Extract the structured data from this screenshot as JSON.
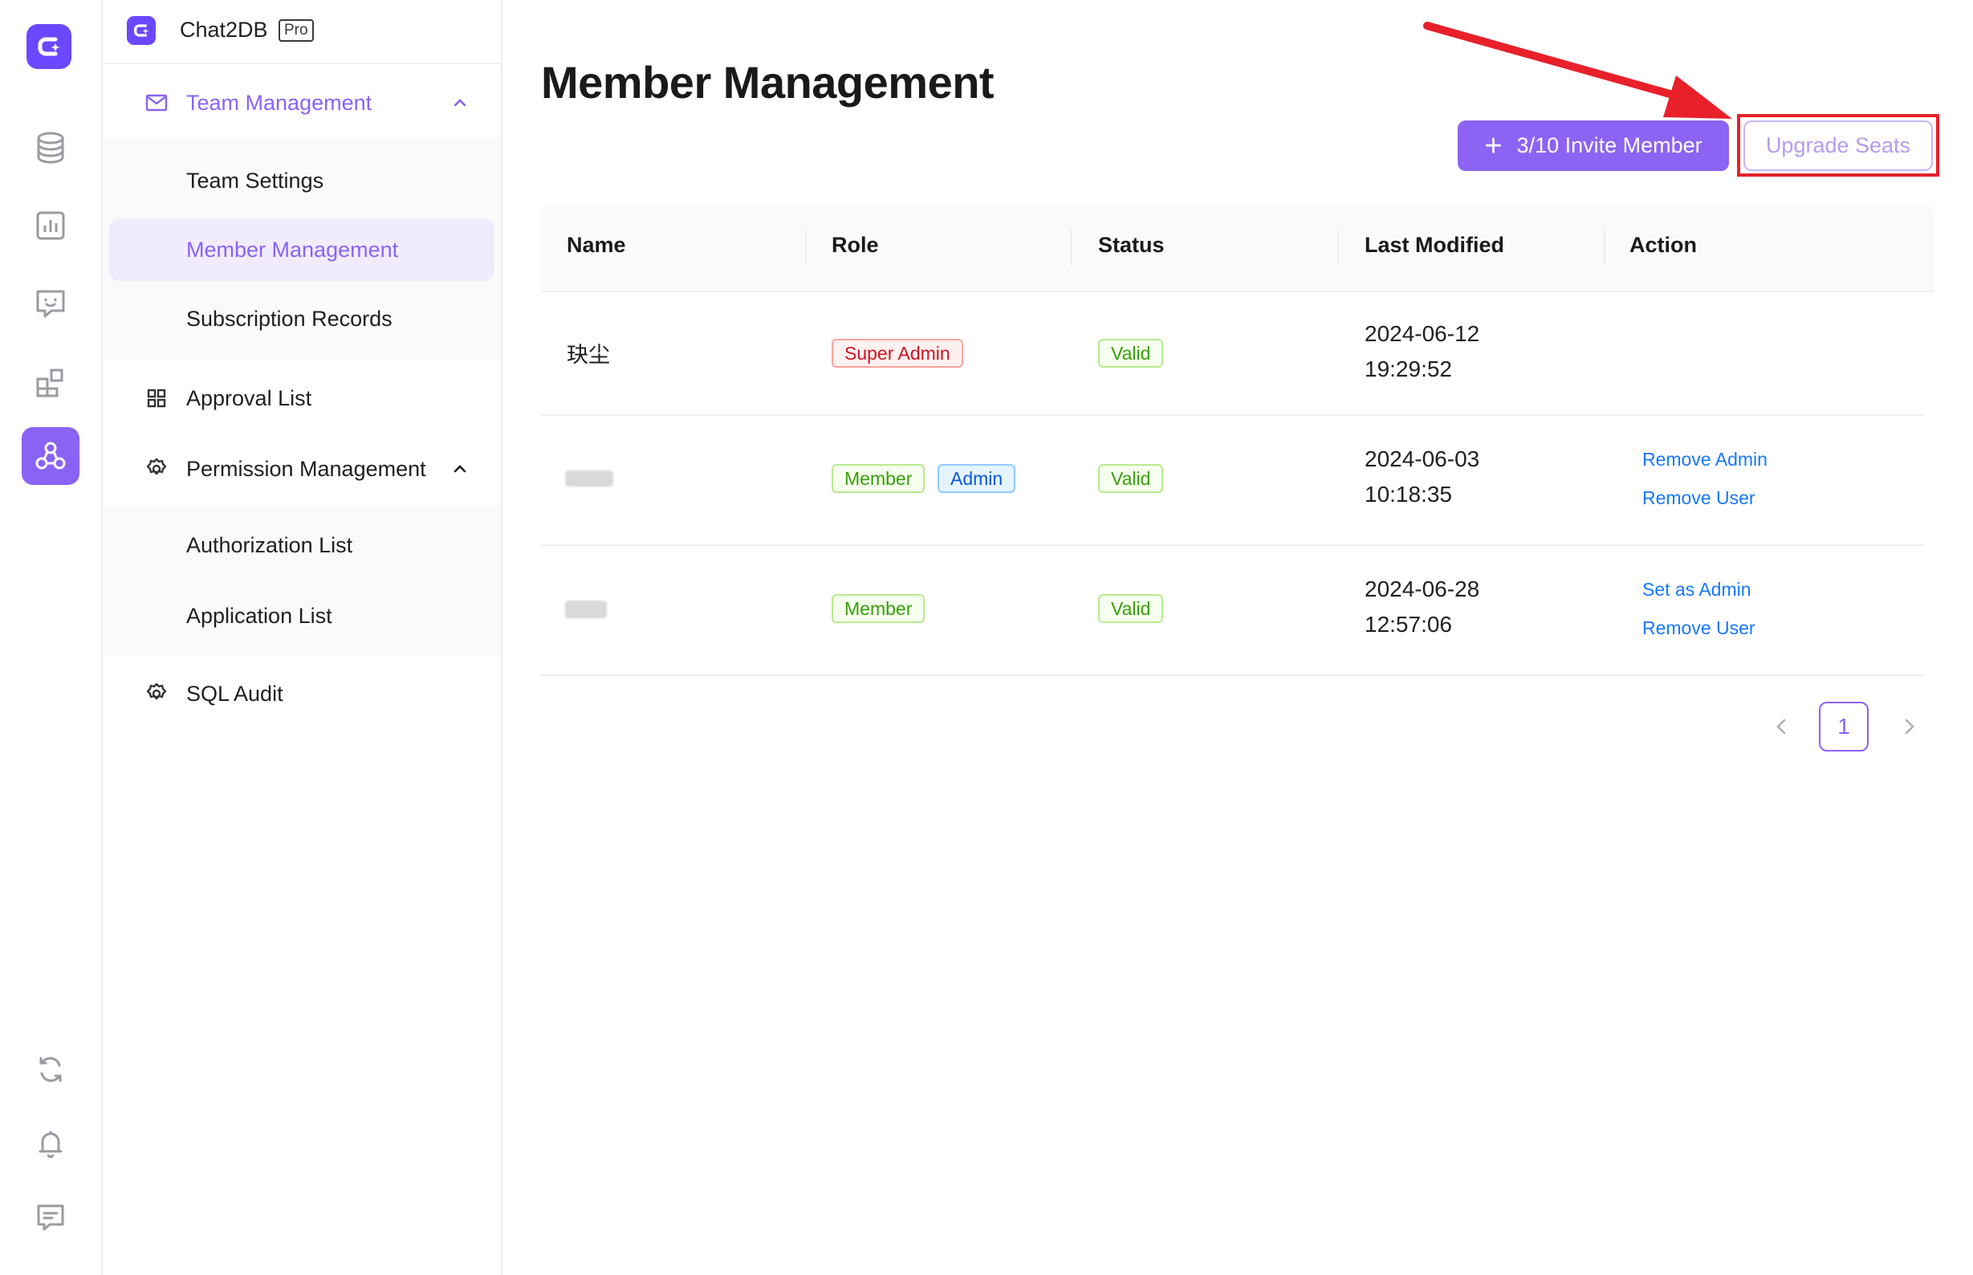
{
  "brand": {
    "name": "Chat2DB",
    "badge": "Pro"
  },
  "rail": {
    "items": [
      "database-icon",
      "chart-icon",
      "chat-bot-icon",
      "apps-icon",
      "team-icon"
    ],
    "bottom": [
      "sync-icon",
      "bell-icon",
      "feedback-icon"
    ]
  },
  "sidebar": {
    "team_management": "Team Management",
    "team_settings": "Team Settings",
    "member_management": "Member Management",
    "subscription_records": "Subscription Records",
    "approval_list": "Approval List",
    "permission_management": "Permission Management",
    "authorization_list": "Authorization List",
    "application_list": "Application List",
    "sql_audit": "SQL Audit"
  },
  "page": {
    "title": "Member Management",
    "invite_button": "3/10 Invite Member",
    "upgrade_button": "Upgrade Seats"
  },
  "table": {
    "headers": {
      "name": "Name",
      "role": "Role",
      "status": "Status",
      "last_modified": "Last Modified",
      "action": "Action"
    },
    "rows": [
      {
        "name": "玦尘",
        "roles": [
          "Super Admin"
        ],
        "status": "Valid",
        "date": "2024-06-12",
        "time": "19:29:52",
        "actions": []
      },
      {
        "name": "",
        "roles": [
          "Member",
          "Admin"
        ],
        "status": "Valid",
        "date": "2024-06-03",
        "time": "10:18:35",
        "actions": [
          "Remove Admin",
          "Remove User"
        ]
      },
      {
        "name": "",
        "roles": [
          "Member"
        ],
        "status": "Valid",
        "date": "2024-06-28",
        "time": "12:57:06",
        "actions": [
          "Set as Admin",
          "Remove User"
        ]
      }
    ]
  },
  "pagination": {
    "current": "1"
  },
  "colors": {
    "accent": "#8a63f5",
    "brand": "#6b48ff",
    "highlight": "#e8202a",
    "link": "#1677ff"
  }
}
